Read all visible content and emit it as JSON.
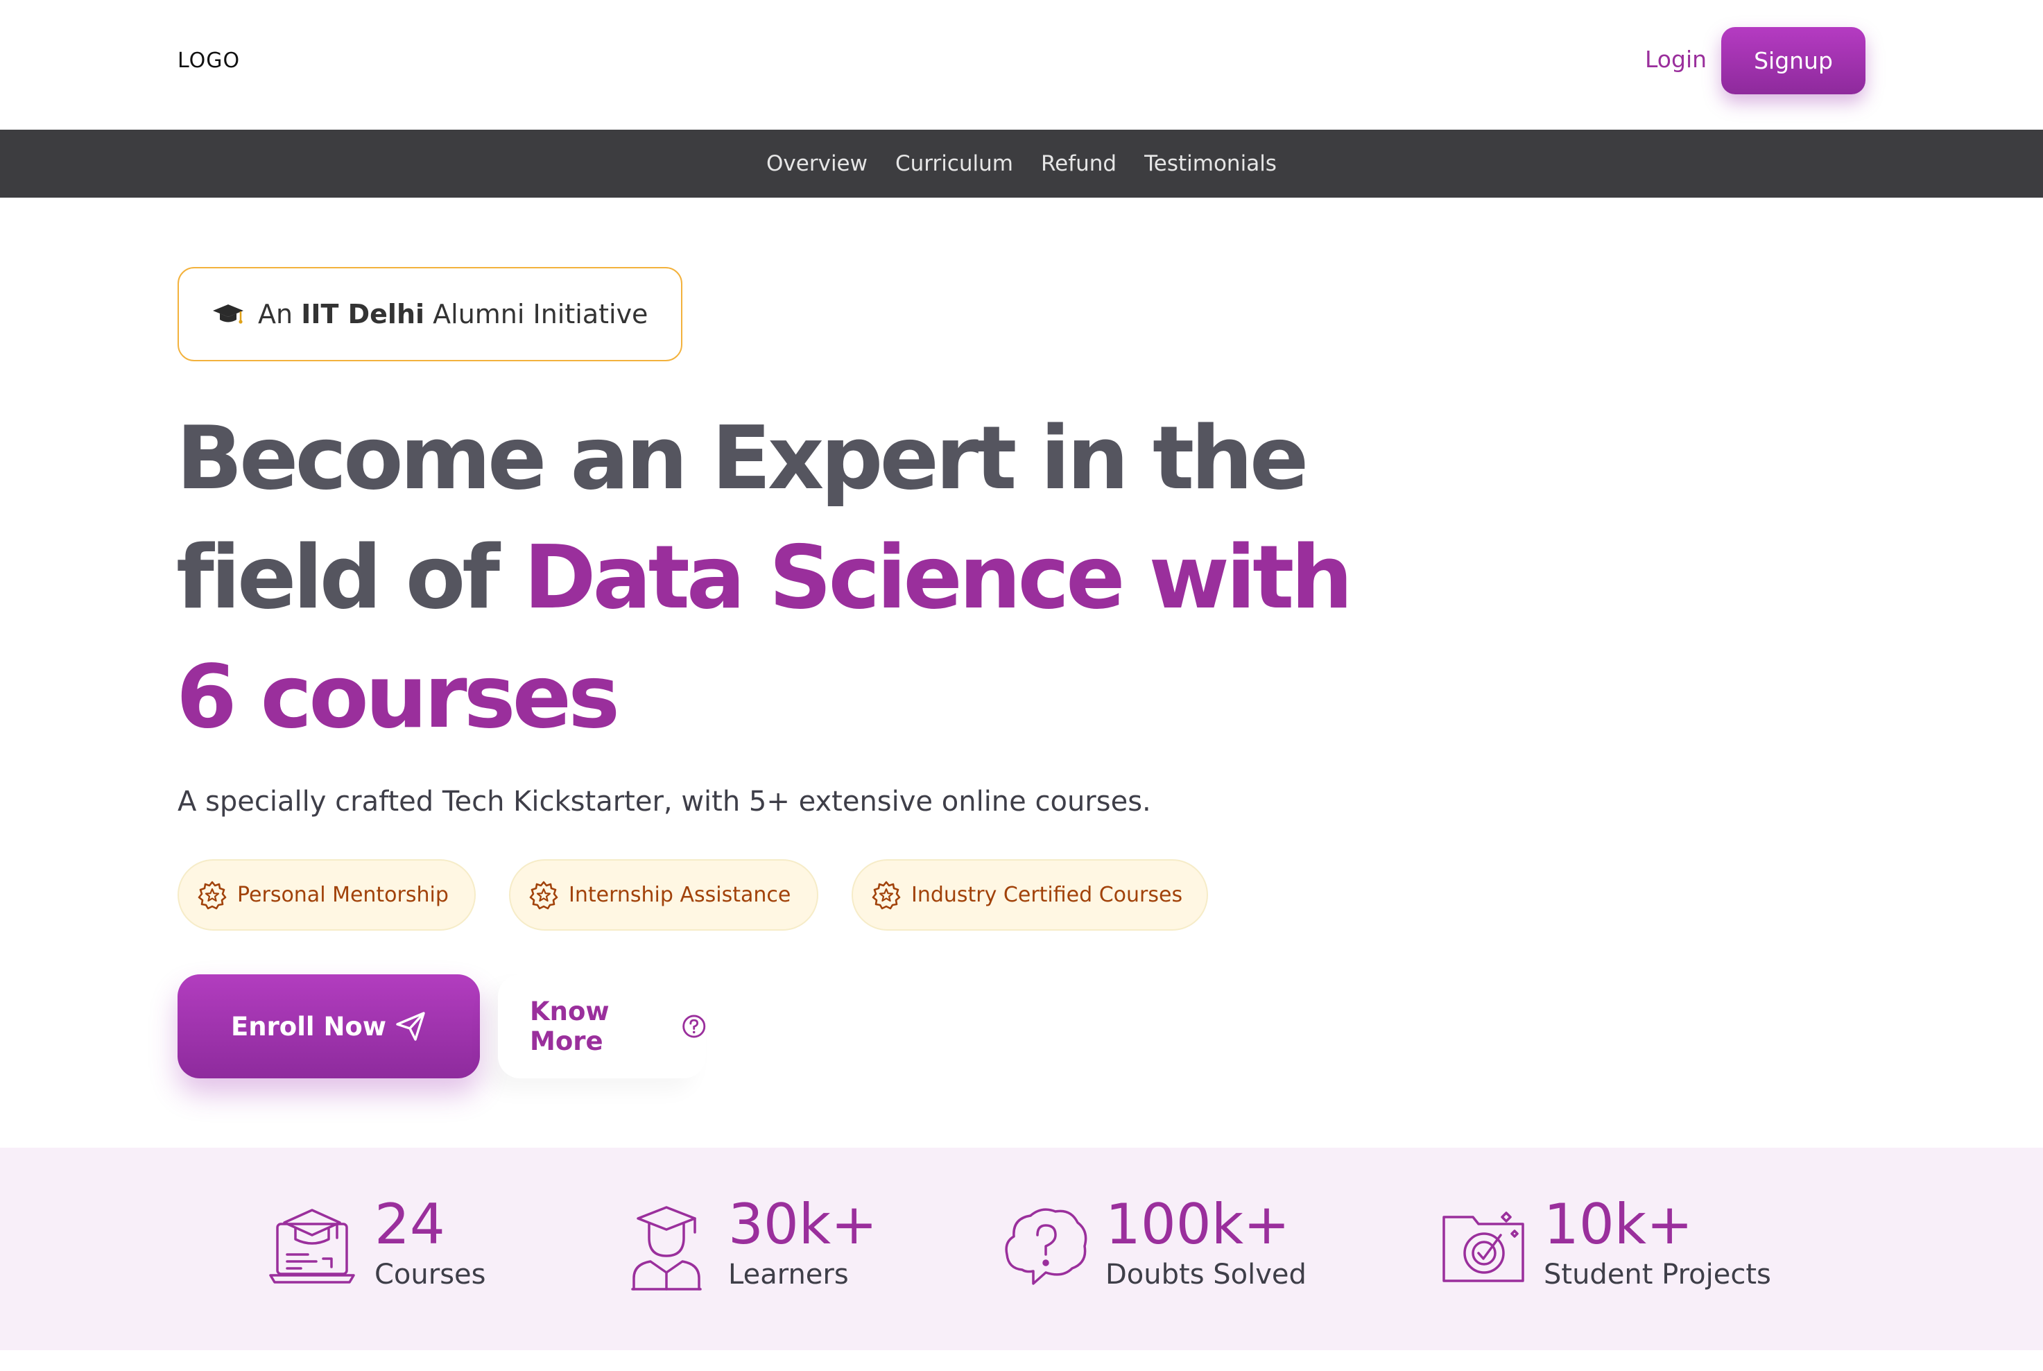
{
  "header": {
    "logo": "LOGO",
    "login_label": "Login",
    "signup_label": "Signup"
  },
  "nav": {
    "items": [
      "Overview",
      "Curriculum",
      "Refund",
      "Testimonials"
    ]
  },
  "badge": {
    "icon": "graduation-cap-icon",
    "prefix": "An",
    "highlight": "IIT Delhi",
    "suffix": "Alumni Initiative"
  },
  "hero": {
    "headline_plain": "Become an Expert in the field of",
    "headline_accent": "Data Science with 6 courses",
    "subtitle": "A specially crafted Tech Kickstarter, with 5+ extensive online courses."
  },
  "features": [
    {
      "icon": "star-badge-icon",
      "label": "Personal Mentorship"
    },
    {
      "icon": "star-badge-icon",
      "label": "Internship Assistance"
    },
    {
      "icon": "star-badge-icon",
      "label": "Industry Certified Courses"
    }
  ],
  "cta": {
    "enroll_label": "Enroll Now",
    "enroll_icon": "paper-plane-icon",
    "know_more_label": "Know More",
    "know_more_icon": "question-circle-icon"
  },
  "stats": [
    {
      "icon": "laptop-graduation-icon",
      "value": "24",
      "label": "Courses"
    },
    {
      "icon": "graduate-student-icon",
      "value": "30k+",
      "label": "Learners"
    },
    {
      "icon": "question-bubble-icon",
      "value": "100k+",
      "label": "Doubts Solved"
    },
    {
      "icon": "target-folder-icon",
      "value": "10k+",
      "label": "Student Projects"
    }
  ],
  "colors": {
    "brand": "#9a2f9c",
    "nav_bg": "#3d3d40",
    "pill_bg": "#fff7e3",
    "pill_text": "#a1420a",
    "badge_border": "#f3b23d",
    "stats_bg": "#f8eff9"
  }
}
